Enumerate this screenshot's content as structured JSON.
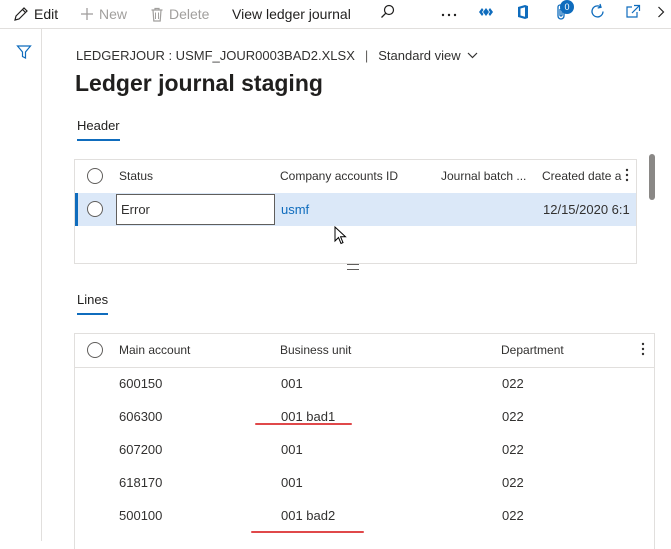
{
  "toolbar": {
    "edit_label": "Edit",
    "new_label": "New",
    "delete_label": "Delete",
    "view_ledger_label": "View ledger journal",
    "attachments_count": "0"
  },
  "breadcrumb": {
    "path": "LEDGERJOUR : USMF_JOUR0003BAD2.XLSX",
    "separator": "|",
    "view": "Standard view"
  },
  "page": {
    "title": "Ledger journal staging"
  },
  "header_section": {
    "tab_label": "Header",
    "columns": [
      "Status",
      "Company accounts ID",
      "Journal batch ...",
      "Created date a"
    ],
    "rows": [
      {
        "status": "Error",
        "company": "usmf",
        "journal_batch": "",
        "created": "12/15/2020 6:1"
      }
    ]
  },
  "lines_section": {
    "tab_label": "Lines",
    "columns": [
      "Main account",
      "Business unit",
      "Department"
    ],
    "rows": [
      {
        "main_account": "600150",
        "business_unit": "001",
        "department": "022"
      },
      {
        "main_account": "606300",
        "business_unit": "001 bad1",
        "department": "022"
      },
      {
        "main_account": "607200",
        "business_unit": "001",
        "department": "022"
      },
      {
        "main_account": "618170",
        "business_unit": "001",
        "department": "022"
      },
      {
        "main_account": "500100",
        "business_unit": "001 bad2",
        "department": "022"
      }
    ]
  },
  "colors": {
    "accent": "#0f6cbd",
    "selected_row": "#dbe8f8",
    "annotation": "#e0484a"
  },
  "icons": [
    "pencil-icon",
    "plus-icon",
    "trash-icon",
    "search-icon",
    "ellipsis-icon",
    "diamond-icon",
    "office-icon",
    "paperclip-icon",
    "refresh-icon",
    "open-icon",
    "chevron-right-icon",
    "filter-icon",
    "chevron-down-icon",
    "more-vertical-icon"
  ]
}
